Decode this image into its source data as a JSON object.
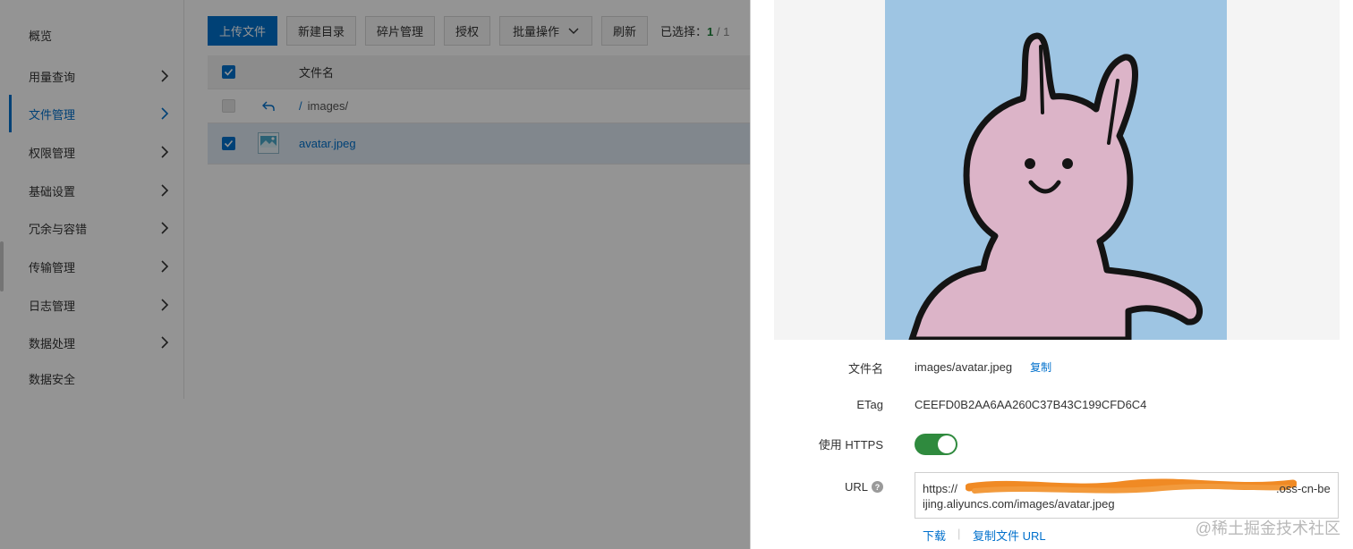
{
  "sidebar": {
    "items": [
      {
        "label": "概览",
        "has_arrow": false
      },
      {
        "label": "用量查询",
        "has_arrow": true
      },
      {
        "label": "文件管理",
        "has_arrow": true,
        "active": true
      },
      {
        "label": "权限管理",
        "has_arrow": true
      },
      {
        "label": "基础设置",
        "has_arrow": true
      },
      {
        "label": "冗余与容错",
        "has_arrow": true
      },
      {
        "label": "传输管理",
        "has_arrow": true
      },
      {
        "label": "日志管理",
        "has_arrow": true
      },
      {
        "label": "数据处理",
        "has_arrow": true
      },
      {
        "label": "数据安全",
        "has_arrow": false
      }
    ]
  },
  "toolbar": {
    "upload_label": "上传文件",
    "new_dir_label": "新建目录",
    "fragment_label": "碎片管理",
    "authorize_label": "授权",
    "batch_label": "批量操作",
    "refresh_label": "刷新",
    "selected_prefix": "已选择：",
    "selected_count": "1",
    "selected_total": " / 1"
  },
  "file_table": {
    "header_name": "文件名",
    "parent_sep": "/",
    "parent_path": "images/",
    "files": [
      {
        "name": "avatar.jpeg",
        "checked": true
      }
    ]
  },
  "details": {
    "filename_label": "文件名",
    "filename_value": "images/avatar.jpeg",
    "copy_label": "复制",
    "etag_label": "ETag",
    "etag_value": "CEEFD0B2AA6AA260C37B43C199CFD6C4",
    "https_label": "使用 HTTPS",
    "https_enabled": true,
    "url_label": "URL",
    "url_prefix": "https://",
    "url_visible": ".oss-cn-beijing.aliyuncs.com/images/avatar.jpeg",
    "download_label": "下载",
    "copy_url_label": "复制文件 URL"
  },
  "watermark": "@稀土掘金技术社区",
  "colors": {
    "accent": "#0070cc",
    "toggle_on": "#2f8a3e",
    "preview_bg": "#9ec5e3",
    "bunny_pink": "#dcb4c8",
    "redaction": "#f08a24"
  }
}
